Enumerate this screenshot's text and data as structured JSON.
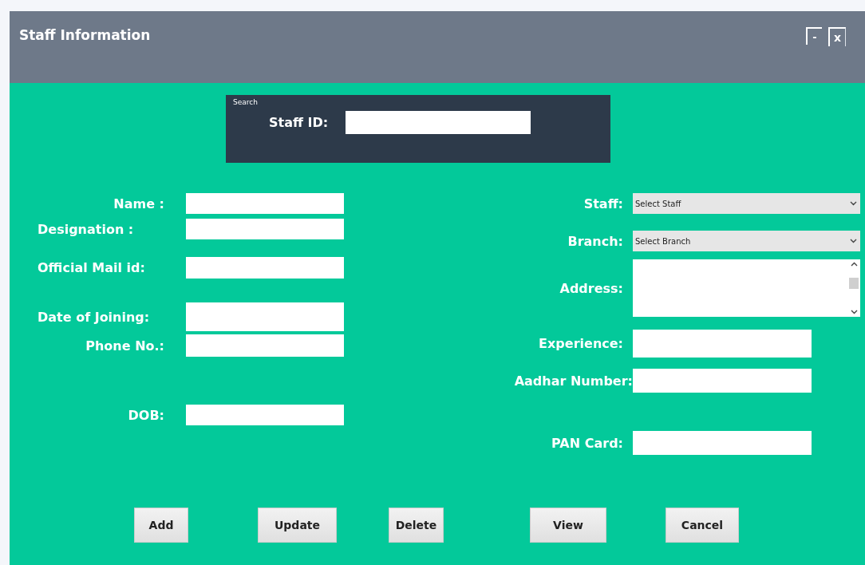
{
  "window": {
    "title": "Staff Information",
    "controls": [
      {
        "kind": "minimize",
        "label": "-"
      },
      {
        "kind": "close",
        "label": "x"
      }
    ]
  },
  "search": {
    "caption": "Search",
    "label": "Staff ID:"
  },
  "left_fields": [
    {
      "kind": "text",
      "label": "Name :"
    },
    {
      "kind": "text",
      "label": "Designation :"
    },
    {
      "kind": "text",
      "label": "Official Mail id:"
    },
    {
      "kind": "text",
      "label": "Date of Joining:"
    },
    {
      "kind": "text",
      "label": "Phone No.:"
    },
    {
      "kind": "text",
      "label": "DOB:"
    }
  ],
  "right_fields": [
    {
      "kind": "select",
      "label": "Staff:",
      "value": "Select Staff"
    },
    {
      "kind": "select",
      "label": "Branch:",
      "value": "Select Branch"
    },
    {
      "kind": "textarea",
      "label": "Address:"
    },
    {
      "kind": "text",
      "label": "Experience:"
    },
    {
      "kind": "text",
      "label": "Aadhar Number:"
    },
    {
      "kind": "text",
      "label": "PAN Card:"
    }
  ],
  "buttons": [
    "Add",
    "Update",
    "Delete",
    "View",
    "Cancel"
  ]
}
